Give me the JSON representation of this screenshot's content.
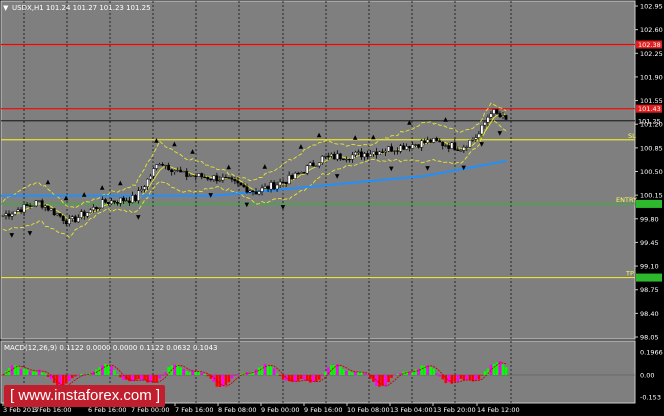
{
  "header": {
    "symbol_info": "USDX,H1  101.24 101.27 101.23 101.25"
  },
  "macd": {
    "info": "MACD(12,26,9) 0.1122 0.0000 0.0000 0.1122 0.0632 0.1043",
    "axis_labels": [
      "0.1966",
      "0.00",
      "-0.153"
    ]
  },
  "price_axis": {
    "labels": [
      "102.95",
      "102.60",
      "102.25",
      "101.90",
      "101.55",
      "101.20",
      "100.85",
      "100.50",
      "100.15",
      "99.80",
      "99.45",
      "99.10",
      "98.75",
      "98.40",
      "98.05"
    ]
  },
  "time_axis": {
    "labels": [
      "3 Feb 2017",
      "3 Feb 16:00",
      "6 Feb 16:00",
      "7 Feb 00:00",
      "7 Feb 16:00",
      "8 Feb 08:00",
      "9 Feb 00:00",
      "9 Feb 16:00",
      "10 Feb 08:00",
      "13 Feb 04:00",
      "13 Feb 20:00",
      "14 Feb 12:00"
    ]
  },
  "levels": {
    "red_upper": "102.38",
    "red_lower": "101.43",
    "current": "101.25",
    "sl": "SL",
    "entry": "ENTRY",
    "tp": "TP"
  },
  "colors": {
    "background": "#7f7f7f",
    "red_line": "#ff0000",
    "yellow_line": "#e6e632",
    "green_line": "#2db82d",
    "ma_line": "#1e90ff",
    "bands": "#e6e632",
    "macd_green": "#00ff00",
    "macd_red": "#ff0000",
    "macd_magenta": "#ff00ff",
    "watermark_bg": "#c21f2e"
  },
  "watermark": "[  www.instaforex.com  ]"
}
